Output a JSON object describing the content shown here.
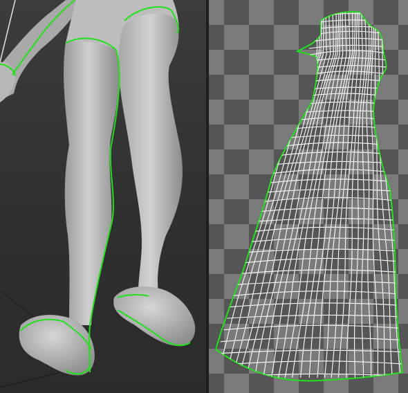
{
  "scene": {
    "viewport_label": "",
    "uv_label": "",
    "colors": {
      "seam": "#22e01c",
      "mesh_shade_light": "#cfcfcf",
      "mesh_shade_dark": "#8e8e8e",
      "uv_wire": "#ffffff",
      "checker_light": "#7a7a7a",
      "checker_dark": "#555555"
    },
    "icons": [
      "camera-frustum-icon",
      "transform-gizmo-icon"
    ]
  }
}
